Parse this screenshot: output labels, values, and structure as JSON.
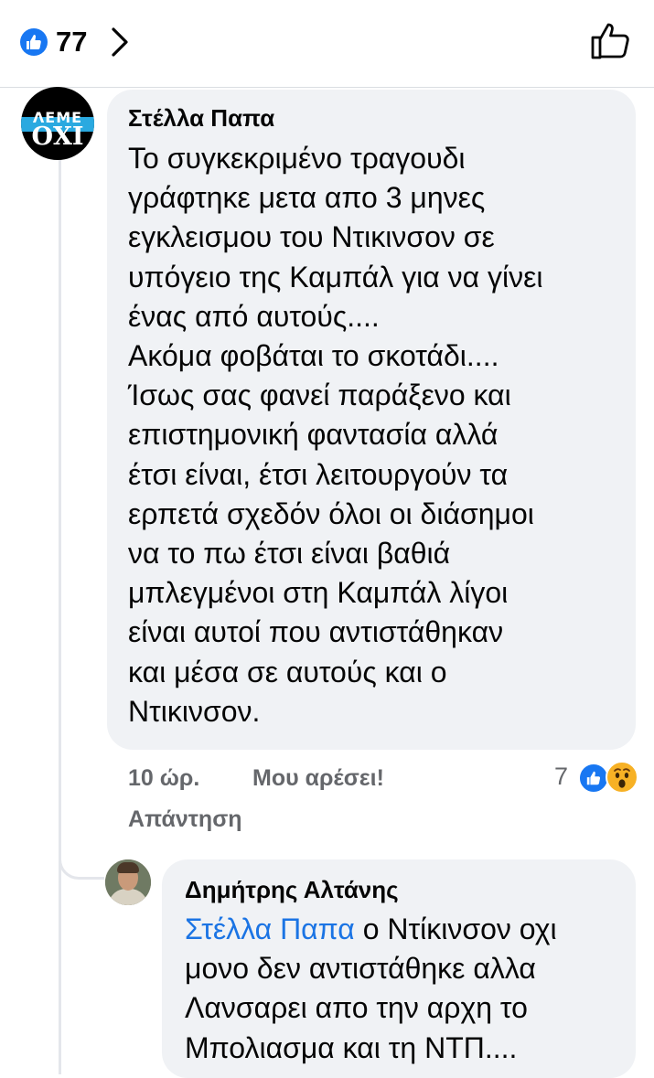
{
  "header": {
    "like_count": "77",
    "icons": [
      "like-badge-icon",
      "chevron-right-icon",
      "thumbs-up-outline-icon"
    ]
  },
  "comment": {
    "author": "Στέλλα Παπα",
    "avatar_text_top": "ΛΕΜΕ",
    "avatar_text_bottom": "ΟΧΙ",
    "lines": [
      "Το συγκεκριμένο τραγουδι",
      "γράφτηκε μετα απο 3 μηνες",
      "εγκλεισμου του Ντικινσον σε",
      "υπόγειο της Καμπάλ για να γίνει",
      "ένας από αυτούς....",
      "Ακόμα φοβάται το σκοτάδι....",
      "Ίσως σας φανεί παράξενο και",
      "επιστημονική φαντασία αλλά",
      "έτσι είναι,  έτσι λειτουργούν τα",
      "ερπετά σχεδόν όλοι οι διάσημοι",
      "να το πω έτσι είναι βαθιά",
      "μπλεγμένοι στη Καμπάλ λίγοι",
      "είναι αυτοί που αντιστάθηκαν",
      "και μέσα σε αυτούς και ο",
      "Ντικινσον."
    ],
    "time": "10 ώρ.",
    "like_label": "Μου αρέσει!",
    "reply_label": "Απάντηση",
    "reaction_count": "7",
    "reaction_icons": [
      "like-reaction-icon",
      "wow-reaction-icon"
    ],
    "colors": {
      "like_blue": "#1877f2",
      "wow_yellow": "#f7b125"
    }
  },
  "reply": {
    "author": "Δημήτρης Αλτάνης",
    "mention": "Στέλλα Παπα",
    "first_line_rest": " ο Ντίκινσον οχι",
    "lines": [
      "μονο δεν αντιστάθηκε αλλα",
      "Λανσαρει απο την αρχη το",
      "Μπολιασμα και τη ΝΤΠ...."
    ],
    "colors": {
      "mention_blue": "#1b74e4"
    }
  }
}
